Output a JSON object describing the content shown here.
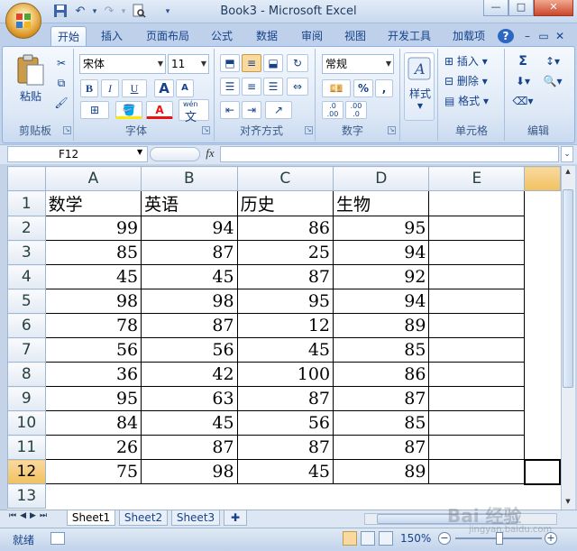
{
  "window": {
    "title": "Book3 - Microsoft Excel",
    "min_label": "—",
    "max_label": "□",
    "close_label": "✕"
  },
  "quick_access": {
    "save": "💾",
    "undo": "↶",
    "redo": "↷",
    "more": "▾"
  },
  "tabs": [
    "开始",
    "插入",
    "页面布局",
    "公式",
    "数据",
    "审阅",
    "视图",
    "开发工具",
    "加载项"
  ],
  "tab_help": "?",
  "ribbon": {
    "clipboard": {
      "label": "剪贴板",
      "paste": "粘贴"
    },
    "font": {
      "label": "字体",
      "name": "宋体",
      "size": "11",
      "bold": "B",
      "italic": "I",
      "underline": "U",
      "grow": "A",
      "shrink": "A",
      "font_color": "A",
      "wen": "wén",
      "wen2": "文"
    },
    "alignment": {
      "label": "对齐方式"
    },
    "number": {
      "label": "数字",
      "format": "常规",
      "percent": "%",
      "comma": ",",
      "inc_decimal": ".0 .00",
      "dec_decimal": ".00 .0"
    },
    "styles": {
      "label": "样式"
    },
    "cells": {
      "label": "单元格",
      "insert": "插入",
      "delete": "删除",
      "format": "格式"
    },
    "editing": {
      "label": "编辑",
      "sum": "Σ"
    }
  },
  "formula_bar": {
    "name_box": "F12",
    "fx": "fx",
    "value": ""
  },
  "sheet": {
    "columns": [
      "A",
      "B",
      "C",
      "D",
      "E"
    ],
    "row_numbers": [
      "1",
      "2",
      "3",
      "4",
      "5",
      "6",
      "7",
      "8",
      "9",
      "10",
      "11",
      "12",
      "13"
    ],
    "headers": [
      "数学",
      "英语",
      "历史",
      "生物"
    ],
    "rows": [
      [
        "99",
        "94",
        "86",
        "95"
      ],
      [
        "85",
        "87",
        "25",
        "94"
      ],
      [
        "45",
        "45",
        "87",
        "92"
      ],
      [
        "98",
        "98",
        "95",
        "94"
      ],
      [
        "78",
        "87",
        "12",
        "89"
      ],
      [
        "56",
        "56",
        "45",
        "85"
      ],
      [
        "36",
        "42",
        "100",
        "86"
      ],
      [
        "95",
        "63",
        "87",
        "87"
      ],
      [
        "84",
        "45",
        "56",
        "85"
      ],
      [
        "26",
        "87",
        "87",
        "87"
      ],
      [
        "75",
        "98",
        "45",
        "89"
      ]
    ],
    "active_cell": "F12"
  },
  "sheet_tabs": [
    "Sheet1",
    "Sheet2",
    "Sheet3"
  ],
  "status": {
    "ready": "就绪",
    "zoom": "150%"
  },
  "watermark": {
    "text": "Bai 经验",
    "url": "jingyan.baidu.com"
  },
  "colors": {
    "ribbon_bg": "#dde8f6",
    "selected_header": "#f1c15f",
    "text": "#15428b"
  }
}
